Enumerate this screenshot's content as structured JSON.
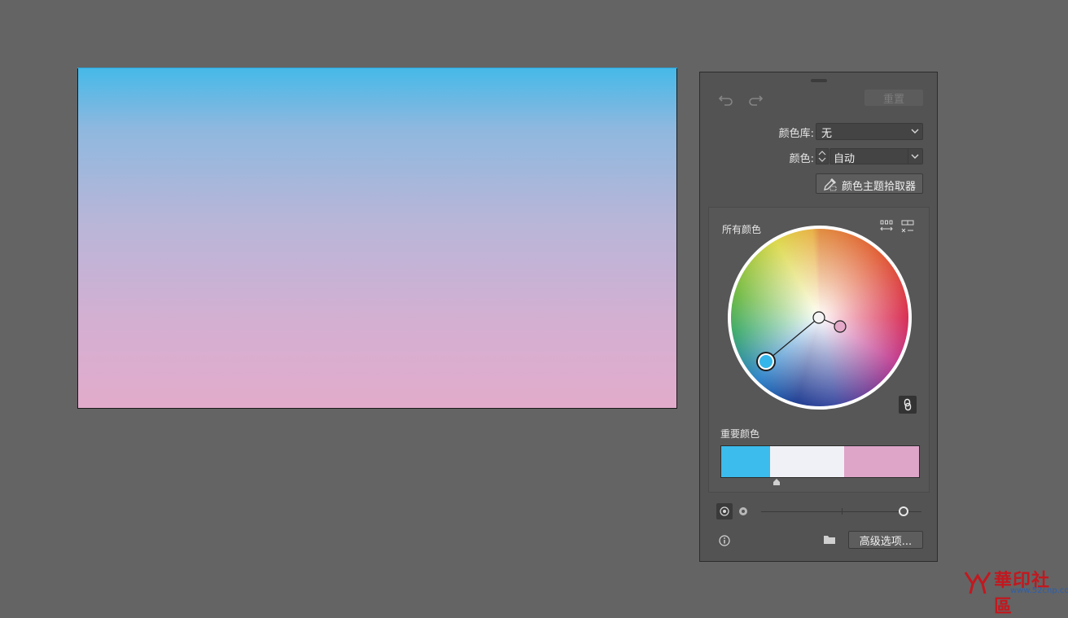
{
  "panel": {
    "reset_label": "重置",
    "library_label": "颜色库:",
    "library_value": "无",
    "colors_label": "颜色:",
    "colors_value": "自动",
    "picker_label": "颜色主题拾取器",
    "all_colors_label": "所有颜色",
    "important_colors_label": "重要颜色",
    "advanced_label": "高级选项...",
    "swatches": [
      {
        "color": "#3bbcec",
        "share": 0.245
      },
      {
        "color": "#f0f1f6",
        "share": 0.375
      },
      {
        "color": "#dea5c9",
        "share": 0.38
      }
    ]
  },
  "watermark": {
    "text": "華印社區",
    "url": "www.52cnp.com"
  }
}
